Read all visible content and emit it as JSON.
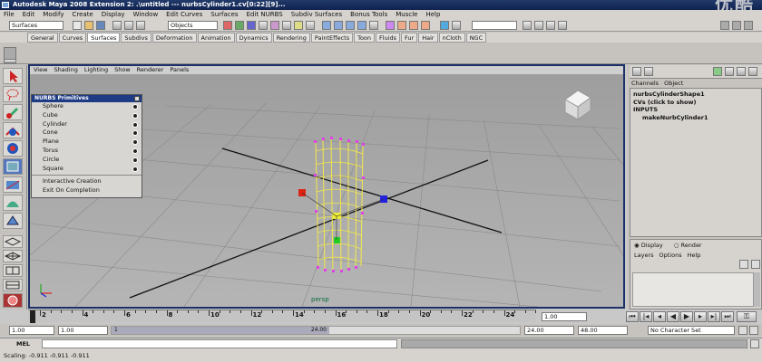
{
  "window": {
    "title": "Autodesk Maya 2008 Extension 2: .\\untitled  ---  nurbsCylinder1.cv[0:22][9]..."
  },
  "watermark": "优酷",
  "menubar": [
    "File",
    "Edit",
    "Modify",
    "Create",
    "Display",
    "Window",
    "Edit Curves",
    "Surfaces",
    "Edit NURBS",
    "Subdiv Surfaces",
    "Bonus Tools",
    "Muscle",
    "Help"
  ],
  "statusline": {
    "menu_set": "Surfaces",
    "select_mode": "Objects"
  },
  "shelf_tabs": [
    "General",
    "Curves",
    "Surfaces",
    "Subdivs",
    "Deformation",
    "Animation",
    "Dynamics",
    "Rendering",
    "PaintEffects",
    "Toon",
    "Fluids",
    "Fur",
    "Hair",
    "nCloth",
    "NGC"
  ],
  "viewport": {
    "menu": [
      "View",
      "Shading",
      "Lighting",
      "Show",
      "Renderer",
      "Panels"
    ],
    "camera_label": "persp"
  },
  "popup": {
    "title": "NURBS Primitives",
    "items": [
      "Sphere",
      "Cube",
      "Cylinder",
      "Cone",
      "Plane",
      "Torus",
      "Circle",
      "Square"
    ],
    "extra_items": [
      "Interactive Creation",
      "Exit On Completion"
    ]
  },
  "channel_box": {
    "menu": [
      "Channels",
      "Object"
    ],
    "lines": [
      "nurbsCylinderShape1",
      "CVs (click to show)",
      "INPUTS",
      "makeNurbCylinder1"
    ]
  },
  "layer_editor": {
    "mode_display": "Display",
    "mode_render": "Render",
    "menu": [
      "Layers",
      "Options",
      "Help"
    ]
  },
  "timeline": {
    "ticks": [
      "2",
      "4",
      "6",
      "8",
      "10",
      "12",
      "14",
      "16",
      "18",
      "20",
      "22",
      "24"
    ],
    "current_frame": "1.00"
  },
  "range": {
    "start": "1.00",
    "playback_start": "1.00",
    "range_mark": "1",
    "range_end_mark": "24.00",
    "end": "24.00",
    "anim_end": "48.00",
    "character_set": "No Character Set"
  },
  "mel": {
    "label": "MEL"
  },
  "help": {
    "text": "Scaling: -0.911      -0.911      -0.911"
  }
}
